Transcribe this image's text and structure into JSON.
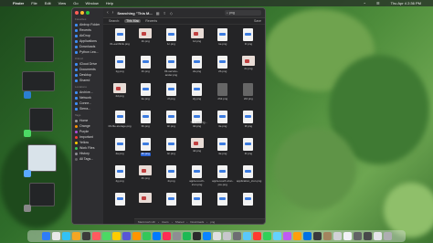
{
  "menubar": {
    "apple": "",
    "items": [
      "Finder",
      "File",
      "Edit",
      "View",
      "Go",
      "Window",
      "Help"
    ],
    "clock": "Thu Apr 4 2:36 PM"
  },
  "finder": {
    "window_title": "Searching \"This M...",
    "back": "‹",
    "forward": "›",
    "search_value": "png",
    "scopes": [
      {
        "label": "Search:",
        "active": false
      },
      {
        "label": "This Mac",
        "active": true
      },
      {
        "label": "Recents",
        "active": false
      }
    ],
    "save_label": "Save",
    "loading_text": "Loading...",
    "sidebar": {
      "favorites_heading": "Favorites",
      "favorites": [
        "Airdrop Folder",
        "Recents",
        "AirDrop",
        "Applications",
        "Downloads",
        "Python Lea..."
      ],
      "icloud_heading": "iCloud",
      "icloud": [
        "iCloud Drive",
        "Documents",
        "Desktop",
        "Shared"
      ],
      "locations_heading": "Locations",
      "locations": [
        "Archive...",
        "Network",
        "Conne...",
        "Sierra..."
      ],
      "tags_heading": "Tags",
      "tags": [
        {
          "label": "Home",
          "color": "#9e9e9e"
        },
        {
          "label": "Orange",
          "color": "#ff9500"
        },
        {
          "label": "Purple",
          "color": "#af52de"
        },
        {
          "label": "Important",
          "color": "#ff3b30"
        },
        {
          "label": "Yellow",
          "color": "#ffcc00"
        },
        {
          "label": "Work Files",
          "color": "#34c759"
        },
        {
          "label": "History",
          "color": "#8e8e93"
        },
        {
          "label": "All Tags...",
          "color": "#636366"
        }
      ]
    },
    "files": [
      {
        "name": "01-earthlink.png",
        "kind": "doc"
      },
      {
        "name": "1b.png",
        "kind": "photo"
      },
      {
        "name": "1c.png",
        "kind": "doc"
      },
      {
        "name": "1d.png",
        "kind": "photo"
      },
      {
        "name": "1e.png",
        "kind": "doc"
      },
      {
        "name": "1f.png",
        "kind": "doc"
      },
      {
        "name": "1g.png",
        "kind": "doc"
      },
      {
        "name": "1h.png",
        "kind": "doc"
      },
      {
        "name": "03-service-ander.png",
        "kind": "doc"
      },
      {
        "name": "2a.png",
        "kind": "doc"
      },
      {
        "name": "2b.png",
        "kind": "doc"
      },
      {
        "name": "2c.png",
        "kind": "photo"
      },
      {
        "name": "2d.png",
        "kind": "photo"
      },
      {
        "name": "2e.png",
        "kind": "doc"
      },
      {
        "name": "2f.png",
        "kind": "doc"
      },
      {
        "name": "2g.png",
        "kind": "doc"
      },
      {
        "name": "2h2.png",
        "kind": "dark"
      },
      {
        "name": "2i2.png",
        "kind": "dark"
      },
      {
        "name": "03-file-storage.png",
        "kind": "doc"
      },
      {
        "name": "3b.png",
        "kind": "doc"
      },
      {
        "name": "3c.png",
        "kind": "doc"
      },
      {
        "name": "3d.png",
        "kind": "doc"
      },
      {
        "name": "3e.png",
        "kind": "doc"
      },
      {
        "name": "3f.png",
        "kind": "doc"
      },
      {
        "name": "4a.png",
        "kind": "doc"
      },
      {
        "name": "4b.png",
        "kind": "doc",
        "selected": true
      },
      {
        "name": "4c.png",
        "kind": "doc"
      },
      {
        "name": "4d.png",
        "kind": "photo"
      },
      {
        "name": "4e.png",
        "kind": "doc"
      },
      {
        "name": "4f.png",
        "kind": "doc"
      },
      {
        "name": "4g.png",
        "kind": "doc"
      },
      {
        "name": "4h.png",
        "kind": "photo"
      },
      {
        "name": "4i.png",
        "kind": "doc"
      },
      {
        "name": "apple-touch-icon.png",
        "kind": "doc"
      },
      {
        "name": "apple-touch-icon-pre.png",
        "kind": "doc"
      },
      {
        "name": "application_icon.png",
        "kind": "doc"
      },
      {
        "name": "",
        "kind": "doc"
      },
      {
        "name": "",
        "kind": "photo"
      },
      {
        "name": "",
        "kind": "doc"
      },
      {
        "name": "",
        "kind": "doc"
      },
      {
        "name": "",
        "kind": "doc"
      },
      {
        "name": "",
        "kind": "doc"
      }
    ],
    "pathbar": [
      "Macintosh HD",
      "Users",
      "Shared",
      "Downloads",
      "png"
    ]
  },
  "dock": {
    "colors": [
      "#2e7cf6",
      "#e8e8e8",
      "#33c2f5",
      "#f5a623",
      "#3b3b3b",
      "#ff5a5f",
      "#4cd964",
      "#ffcc00",
      "#5856d6",
      "#ff9500",
      "#34c759",
      "#007aff",
      "#ff2d55",
      "#8e8e93",
      "#1db954",
      "#2b2b2b",
      "#0a84ff",
      "#e0e0e0",
      "#c7c7cc",
      "#6e6e73",
      "#5ac8fa",
      "#ff3b30",
      "#30d158",
      "#64d2ff",
      "#bf5af2",
      "#ff9f0a",
      "#0071e3",
      "#3a3a3c",
      "#a2845e",
      "#d1d1d6",
      "#f2f2f7",
      "#636366",
      "#48484a",
      "#e5e5ea",
      "#aeaeb2"
    ]
  }
}
